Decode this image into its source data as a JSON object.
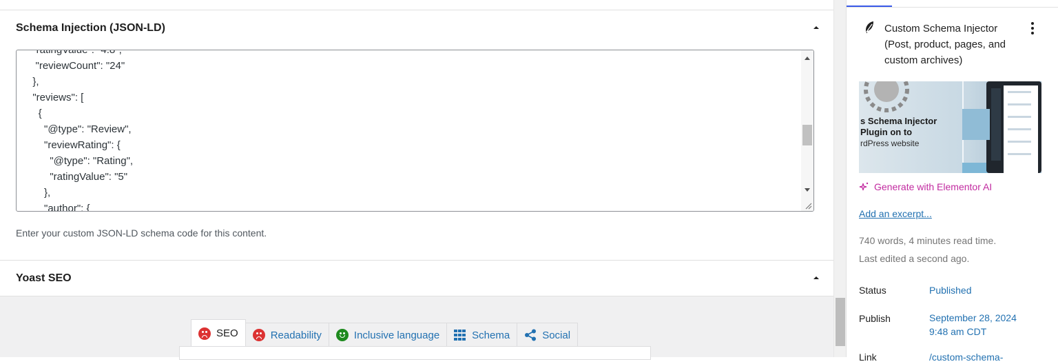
{
  "schema_panel": {
    "title": "Schema Injection (JSON-LD)",
    "code": "  \"ratingValue\": \"4.8\",\n   \"reviewCount\": \"24\"\n  },\n  \"reviews\": [\n    {\n      \"@type\": \"Review\",\n      \"reviewRating\": {\n        \"@type\": \"Rating\",\n        \"ratingValue\": \"5\"\n      },\n      \"author\": {",
    "help_text": "Enter your custom JSON-LD schema code for this content."
  },
  "yoast": {
    "title": "Yoast SEO",
    "tabs": [
      {
        "label": "SEO",
        "icon": "sad-face-icon"
      },
      {
        "label": "Readability",
        "icon": "sad-face-icon"
      },
      {
        "label": "Inclusive language",
        "icon": "smile-face-icon"
      },
      {
        "label": "Schema",
        "icon": "grid-icon"
      },
      {
        "label": "Social",
        "icon": "share-icon"
      }
    ]
  },
  "sidebar": {
    "template_title": "Custom Schema Injector (Post, product, pages, and custom archives)",
    "featured_image_text": [
      "s Schema Injector",
      "Plugin on to",
      "rdPress website"
    ],
    "generate_ai": "Generate with Elementor AI",
    "add_excerpt": "Add an excerpt...",
    "word_count": "740 words, 4 minutes read time.",
    "last_edited": "Last edited a second ago.",
    "status_label": "Status",
    "status_value": "Published",
    "publish_label": "Publish",
    "publish_date": "September 28, 2024",
    "publish_time": "9:48 am CDT",
    "link_label": "Link",
    "link_value": "/custom-schema-"
  },
  "colors": {
    "link": "#2271b1",
    "ai_accent": "#c22ba0",
    "sad_red": "#dc3232",
    "happy_green": "#1e8a1e"
  }
}
